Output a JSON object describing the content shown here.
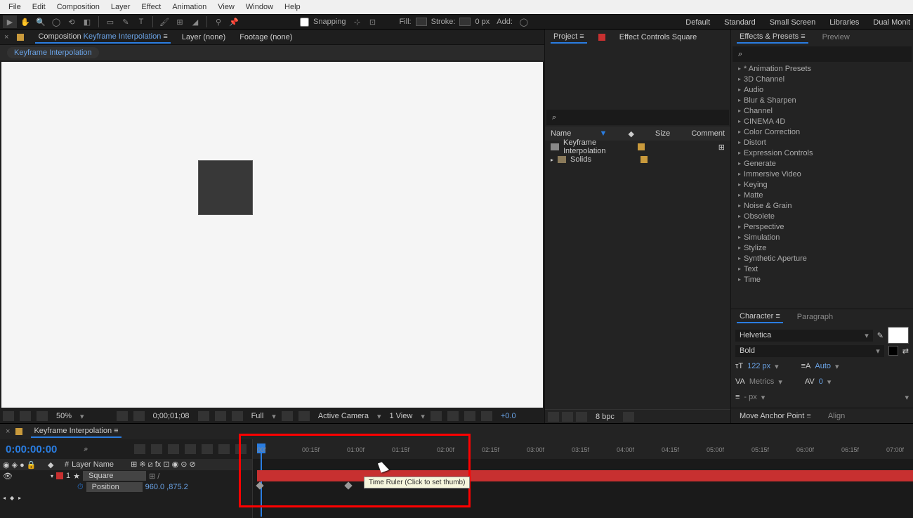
{
  "menubar": [
    "File",
    "Edit",
    "Composition",
    "Layer",
    "Effect",
    "Animation",
    "View",
    "Window",
    "Help"
  ],
  "toolbar": {
    "snapping": "Snapping",
    "fill": "Fill:",
    "stroke": "Stroke:",
    "stroke_px": "0 px",
    "add": "Add:"
  },
  "workspaces": [
    "Default",
    "Standard",
    "Small Screen",
    "Libraries",
    "Dual Monit"
  ],
  "comp_tabs": {
    "composition": "Composition",
    "comp_name": "Keyframe Interpolation",
    "layer": "Layer",
    "layer_val": "(none)",
    "footage": "Footage",
    "footage_val": "(none)"
  },
  "breadcrumb": "Keyframe Interpolation",
  "viewer_footer": {
    "zoom": "50%",
    "time": "0;00;01;08",
    "resolution": "Full",
    "camera": "Active Camera",
    "view": "1 View",
    "exposure": "+0.0"
  },
  "project": {
    "tab_project": "Project",
    "tab_effect": "Effect Controls",
    "tab_effect_layer": "Square",
    "cols": {
      "name": "Name",
      "size": "Size",
      "comment": "Comment"
    },
    "items": [
      {
        "name": "Keyframe Interpolation",
        "color": "#c99a3c",
        "type": "comp"
      },
      {
        "name": "Solids",
        "color": "#c99a3c",
        "type": "folder"
      }
    ],
    "bpc": "8 bpc"
  },
  "effects": {
    "tab_eff": "Effects & Presets",
    "tab_preview": "Preview",
    "items": [
      "* Animation Presets",
      "3D Channel",
      "Audio",
      "Blur & Sharpen",
      "Channel",
      "CINEMA 4D",
      "Color Correction",
      "Distort",
      "Expression Controls",
      "Generate",
      "Immersive Video",
      "Keying",
      "Matte",
      "Noise & Grain",
      "Obsolete",
      "Perspective",
      "Simulation",
      "Stylize",
      "Synthetic Aperture",
      "Text",
      "Time"
    ]
  },
  "character": {
    "tab_char": "Character",
    "tab_para": "Paragraph",
    "font": "Helvetica",
    "style": "Bold",
    "size_label": "122 px",
    "leading": "Auto",
    "kerning": "Metrics",
    "tracking": "0",
    "stroke_px": "- px"
  },
  "move_anchor": {
    "tab": "Move Anchor Point",
    "align": "Align"
  },
  "timeline": {
    "comp_name": "Keyframe Interpolation",
    "timecode": "0:00:00:00",
    "header": {
      "num": "#",
      "layer_name": "Layer Name"
    },
    "layer": {
      "num": "1",
      "name": "Square"
    },
    "prop": {
      "name": "Position",
      "value": "960.0 ,875.2"
    },
    "ticks": [
      "00f",
      "00:15f",
      "01:00f",
      "01:15f",
      "02:00f",
      "02:15f",
      "03:00f",
      "03:15f",
      "04:00f",
      "04:15f",
      "05:00f",
      "05:15f",
      "06:00f",
      "06:15f",
      "07:00f"
    ],
    "tooltip": "Time Ruler (Click to set thumb)"
  }
}
